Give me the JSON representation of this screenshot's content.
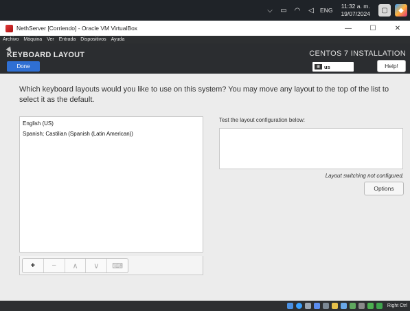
{
  "taskbar": {
    "language": "ENG",
    "time": "11:32 a. m.",
    "date": "19/07/2024"
  },
  "window": {
    "title": "NethServer [Corriendo] - Oracle VM VirtualBox",
    "minimize": "—",
    "maximize": "☐",
    "close": "✕"
  },
  "menubar": {
    "items": [
      "Archivo",
      "Máquina",
      "Ver",
      "Entrada",
      "Dispositivos",
      "Ayuda"
    ]
  },
  "header": {
    "title": "KEYBOARD LAYOUT",
    "done_label": "Done",
    "product": "CENTOS 7 INSTALLATION",
    "keyboard_indicator": "us",
    "help_label": "Help!"
  },
  "main": {
    "question": "Which keyboard layouts would you like to use on this system?  You may move any layout to the top of the list to select it as the default.",
    "layouts": [
      "English (US)",
      "Spanish; Castilian (Spanish (Latin American))"
    ],
    "toolbar": {
      "add": "+",
      "remove": "−",
      "up": "∧",
      "down": "∨",
      "preview": "⌨"
    },
    "test_label": "Test the layout configuration below:",
    "test_value": "",
    "switching_note": "Layout switching not configured.",
    "options_label": "Options"
  },
  "statusbar": {
    "host_key": "Right Ctrl"
  },
  "colors": {
    "accent": "#2f6fd3",
    "header_bg": "#2b2d30",
    "content_bg": "#ececec"
  }
}
